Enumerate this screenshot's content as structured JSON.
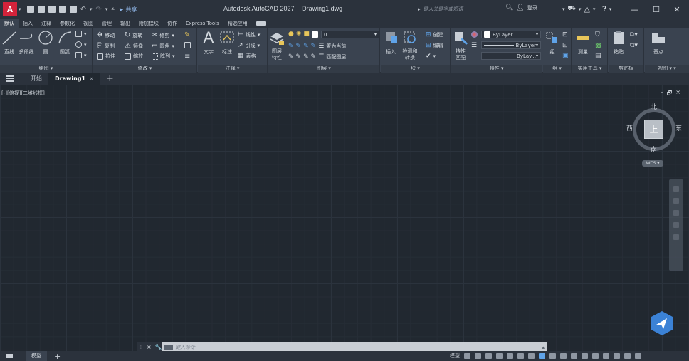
{
  "titlebar": {
    "share_label": "共享",
    "app_name": "Autodesk AutoCAD 2027",
    "file_name": "Drawing1.dwg",
    "search_placeholder": "键入关键字或短语",
    "signin_label": "登录"
  },
  "ribbon_tabs": [
    "默认",
    "插入",
    "注释",
    "参数化",
    "视图",
    "管理",
    "输出",
    "附加模块",
    "协作",
    "Express Tools",
    "精选应用"
  ],
  "ribbon": {
    "draw": {
      "label": "绘图 ▾",
      "line": "直线",
      "polyline": "多段线",
      "circle": "圆",
      "arc": "圆弧"
    },
    "modify": {
      "label": "修改 ▾",
      "move": "移动",
      "rotate": "旋转",
      "trim": "修剪",
      "copy": "复制",
      "mirror": "镜像",
      "fillet": "圆角",
      "stretch": "拉伸",
      "scale": "缩放",
      "array": "阵列"
    },
    "annotation": {
      "label": "注释 ▾",
      "text": "文字",
      "dimension": "标注",
      "linear": "线性",
      "leader": "引线",
      "table": "表格"
    },
    "layers": {
      "label": "图层 ▾",
      "layer_props": "图层\n特性",
      "layer_value": "0",
      "make_current": "置为当前",
      "match_layer": "匹配图层"
    },
    "block": {
      "label": "块 ▾",
      "insert": "插入",
      "detect": "检测和\n转换",
      "create": "创建",
      "edit": "编辑"
    },
    "properties": {
      "label": "特性 ▾",
      "match": "特性\n匹配",
      "color": "ByLayer",
      "linetype": "ByLayer",
      "lineweight": "ByLay..."
    },
    "group": {
      "label": "组 ▾",
      "group": "组"
    },
    "utilities": {
      "label": "实用工具 ▾",
      "measure": "测量"
    },
    "clipboard": {
      "label": "剪贴板",
      "paste": "粘贴"
    },
    "view": {
      "label": "视图 ▾ ▾",
      "base": "基点"
    }
  },
  "filetabs": {
    "start": "开始",
    "drawing": "Drawing1",
    "close": "×",
    "add": "+"
  },
  "viewport": {
    "label": "[-][俯视][二维线框]",
    "controls": [
      "–",
      "🗗",
      "×"
    ],
    "viewcube": {
      "top": "上",
      "north": "北",
      "south": "南",
      "east": "东",
      "west": "西",
      "wcs": "WCS ▾"
    }
  },
  "cmdline": {
    "placeholder": "键入命令",
    "close": "×",
    "wrench": "🔧"
  },
  "statusbar": {
    "model": "模型",
    "add": "+",
    "model_right": "模型"
  },
  "colors": {
    "background": "#212830",
    "ribbon": "#3a4350",
    "accent": "#5fa3e8",
    "logo": "#d3233b"
  }
}
